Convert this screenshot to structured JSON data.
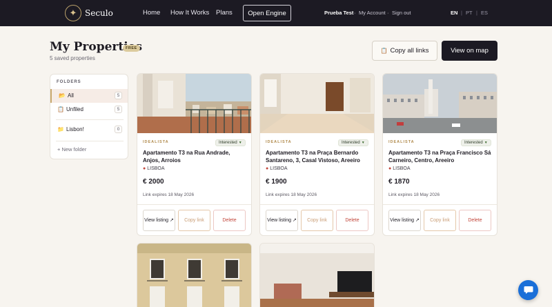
{
  "nav": {
    "brand": "Seculo",
    "links": [
      "Home",
      "How It Works",
      "Plans"
    ],
    "open_engine": "Open Engine",
    "user": "Prueba Test",
    "my_account": "My Account",
    "sign_out": "Sign out",
    "languages": [
      "EN",
      "PT",
      "ES"
    ],
    "active_language": "EN"
  },
  "header": {
    "title": "My Properties",
    "badge": "FREE",
    "subtitle": "5 saved properties",
    "copy_all_label": "Copy all links",
    "view_map_label": "View on map"
  },
  "folders": {
    "heading": "FOLDERS",
    "items": [
      {
        "icon": "📂",
        "label": "All",
        "count": "5",
        "active": true
      },
      {
        "icon": "📋",
        "label": "Unfiled",
        "count": "5",
        "active": false
      },
      {
        "icon": "📁",
        "label": "Lisbon!",
        "count": "0",
        "active": false
      }
    ],
    "new_folder": "+ New folder"
  },
  "cards": [
    {
      "source": "IDEALISTA",
      "status": "Interested",
      "title": "Apartamento T3 na Rua Andrade, Anjos, Arroios",
      "city": "LISBOA",
      "price": "€ 2000",
      "expires": "Link expires 18 May 2026",
      "view_label": "View listing ↗",
      "copy_label": "Copy link",
      "delete_label": "Delete"
    },
    {
      "source": "IDEALISTA",
      "status": "Interested",
      "title": "Apartamento T3 na Praça Bernardo Santareno, 3, Casal Vistoso, Areeiro",
      "city": "LISBOA",
      "price": "€ 1900",
      "expires": "Link expires 18 May 2026",
      "view_label": "View listing ↗",
      "copy_label": "Copy link",
      "delete_label": "Delete"
    },
    {
      "source": "IDEALISTA",
      "status": "Interested",
      "title": "Apartamento T3 na Praça Francisco Sá Carneiro, Centro, Areeiro",
      "city": "LISBOA",
      "price": "€ 1870",
      "expires": "Link expires 18 May 2026",
      "view_label": "View listing ↗",
      "copy_label": "Copy link",
      "delete_label": "Delete"
    }
  ],
  "colors": {
    "nav_bg": "#1c1a23",
    "accent_gold": "#c9a96e",
    "delete_red": "#c2453a",
    "chat_blue": "#1a6fd8"
  }
}
